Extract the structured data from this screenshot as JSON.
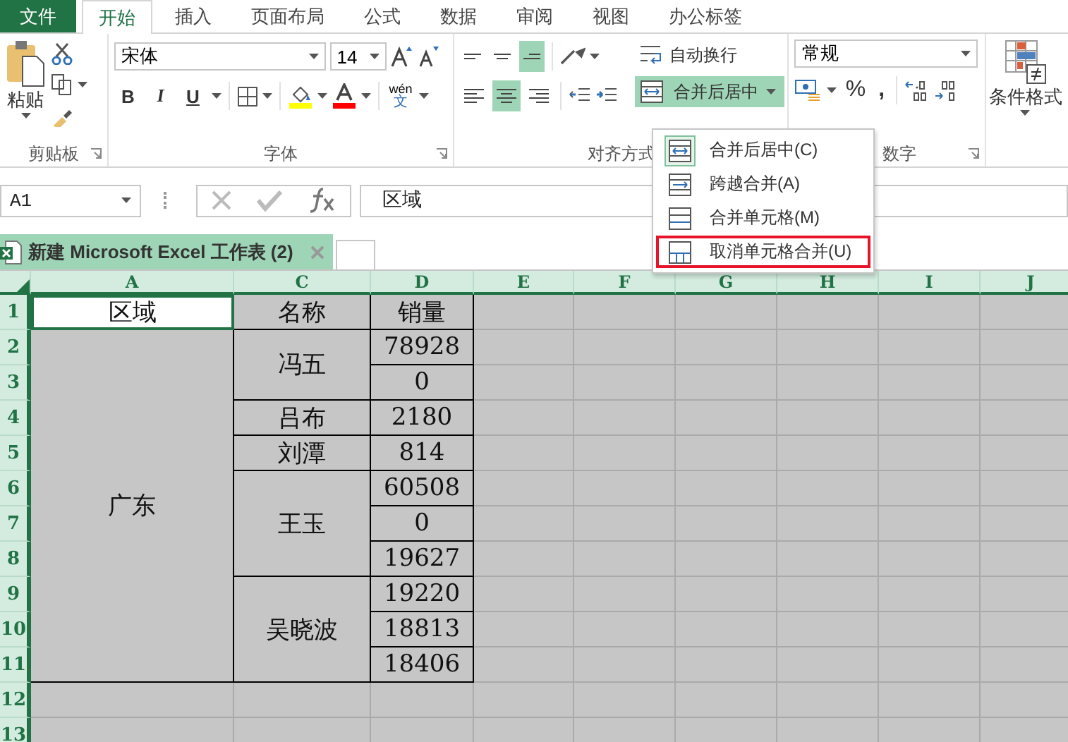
{
  "ribbon_tabs": [
    {
      "label": "文件",
      "kind": "file",
      "selected": false
    },
    {
      "label": "开始",
      "kind": "tab",
      "selected": true
    },
    {
      "label": "插入",
      "kind": "tab",
      "selected": false
    },
    {
      "label": "页面布局",
      "kind": "tab",
      "selected": false
    },
    {
      "label": "公式",
      "kind": "tab",
      "selected": false
    },
    {
      "label": "数据",
      "kind": "tab",
      "selected": false
    },
    {
      "label": "审阅",
      "kind": "tab",
      "selected": false
    },
    {
      "label": "视图",
      "kind": "tab",
      "selected": false
    },
    {
      "label": "办公标签",
      "kind": "tab",
      "selected": false
    }
  ],
  "clipboard": {
    "paste_label": "粘贴",
    "group_label": "剪贴板"
  },
  "font": {
    "name": "宋体",
    "size": "14",
    "style_buttons": [
      {
        "label": "B",
        "kind": "bold"
      },
      {
        "label": "I",
        "kind": "italic"
      },
      {
        "label": "U",
        "kind": "underline"
      }
    ],
    "phonetic_top": "wén",
    "phonetic_bottom": "文",
    "group_label": "字体"
  },
  "alignment": {
    "vertical": [
      {
        "kind": "top",
        "selected": false
      },
      {
        "kind": "middle",
        "selected": false
      },
      {
        "kind": "bottom",
        "selected": true
      }
    ],
    "horizontal": [
      {
        "kind": "left",
        "selected": false
      },
      {
        "kind": "center",
        "selected": true
      },
      {
        "kind": "right",
        "selected": false
      }
    ],
    "wrap_label": "自动换行",
    "merge_label": "合并后居中",
    "merge_open": true,
    "group_label": "对齐方式"
  },
  "number": {
    "format": "常规",
    "percent": "%",
    "comma": ",",
    "group_label": "数字"
  },
  "styles": {
    "conditional_label": "条件格式"
  },
  "merge_menu": [
    {
      "label": "合并后居中(C)",
      "kind": "merge-center",
      "current": true,
      "annotated": false
    },
    {
      "label": "跨越合并(A)",
      "kind": "merge-across",
      "current": false,
      "annotated": false
    },
    {
      "label": "合并单元格(M)",
      "kind": "merge-cells",
      "current": false,
      "annotated": false
    },
    {
      "label": "取消单元格合并(U)",
      "kind": "unmerge",
      "current": false,
      "annotated": true
    }
  ],
  "formula_bar": {
    "name_box": "A1",
    "formula": "区域"
  },
  "document_tab": {
    "title": "新建 Microsoft Excel 工作表 (2)"
  },
  "column_headers": [
    "A",
    "C",
    "D",
    "E",
    "F",
    "G",
    "H",
    "I",
    "J"
  ],
  "row_headers": [
    "1",
    "2",
    "3",
    "4",
    "5",
    "6",
    "7",
    "8",
    "9",
    "10",
    "11",
    "12",
    "13"
  ],
  "table": {
    "header": [
      "区域",
      "名称",
      "销量"
    ],
    "groups": [
      {
        "region": "广东",
        "people": [
          {
            "name": "冯五",
            "sales": [
              "78928",
              "0"
            ]
          },
          {
            "name": "吕布",
            "sales": [
              "2180"
            ]
          },
          {
            "name": "刘潭",
            "sales": [
              "814"
            ]
          },
          {
            "name": "王玉",
            "sales": [
              "60508",
              "0",
              "19627"
            ]
          },
          {
            "name": "吴晓波",
            "sales": [
              "19220",
              "18813",
              "18406"
            ]
          }
        ]
      }
    ]
  }
}
